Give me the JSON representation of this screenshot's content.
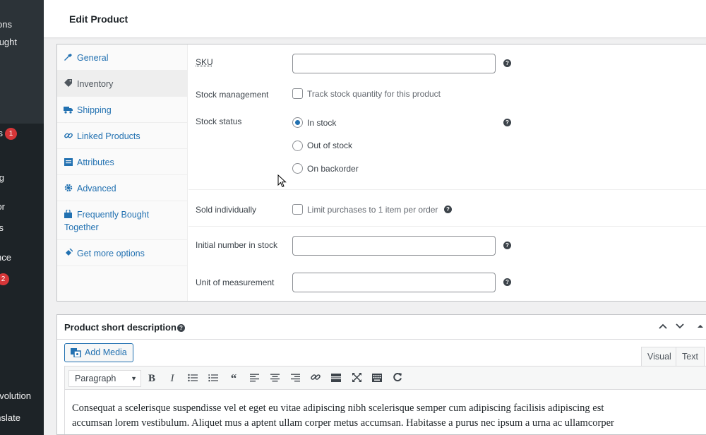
{
  "admin_menu": {
    "items": [
      {
        "label": "ons"
      },
      {
        "label": "ught"
      },
      {
        "label": "s"
      },
      {
        "label": "g"
      },
      {
        "label": "or"
      },
      {
        "label": "s"
      },
      {
        "label": "nce"
      },
      {
        "label": "volution"
      },
      {
        "label": "nslate"
      }
    ],
    "badges": [
      "1",
      "2"
    ]
  },
  "page_title": "Edit Product",
  "product_data": {
    "tabs": [
      {
        "label": "General",
        "icon": "wrench-icon"
      },
      {
        "label": "Inventory",
        "icon": "tag-icon"
      },
      {
        "label": "Shipping",
        "icon": "truck-icon"
      },
      {
        "label": "Linked Products",
        "icon": "link-icon"
      },
      {
        "label": "Attributes",
        "icon": "list-icon"
      },
      {
        "label": "Advanced",
        "icon": "gear-icon"
      },
      {
        "label": "Frequently Bought Together",
        "icon": "bag-icon"
      },
      {
        "label": "Get more options",
        "icon": "plugin-icon"
      }
    ],
    "active_tab": "Inventory",
    "inventory": {
      "sku_label": "SKU",
      "sku_value": "",
      "stock_management_label": "Stock management",
      "stock_management_checkbox": "Track stock quantity for this product",
      "stock_management_checked": false,
      "stock_status_label": "Stock status",
      "stock_status_options": [
        "In stock",
        "Out of stock",
        "On backorder"
      ],
      "stock_status_selected": "In stock",
      "sold_individually_label": "Sold individually",
      "sold_individually_checkbox": "Limit purchases to 1 item per order",
      "sold_individually_checked": false,
      "initial_stock_label": "Initial number in stock",
      "initial_stock_value": "",
      "unit_label": "Unit of measurement",
      "unit_value": ""
    }
  },
  "short_description": {
    "title": "Product short description",
    "add_media": "Add Media",
    "editor_tabs": [
      "Visual",
      "Text"
    ],
    "active_editor_tab": "Visual",
    "format_select": "Paragraph",
    "content_line1": "Consequat a scelerisque suspendisse vel et eget eu vitae adipiscing nibh scelerisque semper cum adipiscing facilisis adipiscing est",
    "content_line2": "accumsan lorem vestibulum. Aliquet mus a aptent ullam corper metus accumsan. Habitasse a purus nec ipsum a urna ac ullamcorper"
  },
  "help_icon_glyph": "?",
  "colors": {
    "link": "#2271b1",
    "admin_bg": "#1d2327",
    "badge": "#d63638"
  }
}
